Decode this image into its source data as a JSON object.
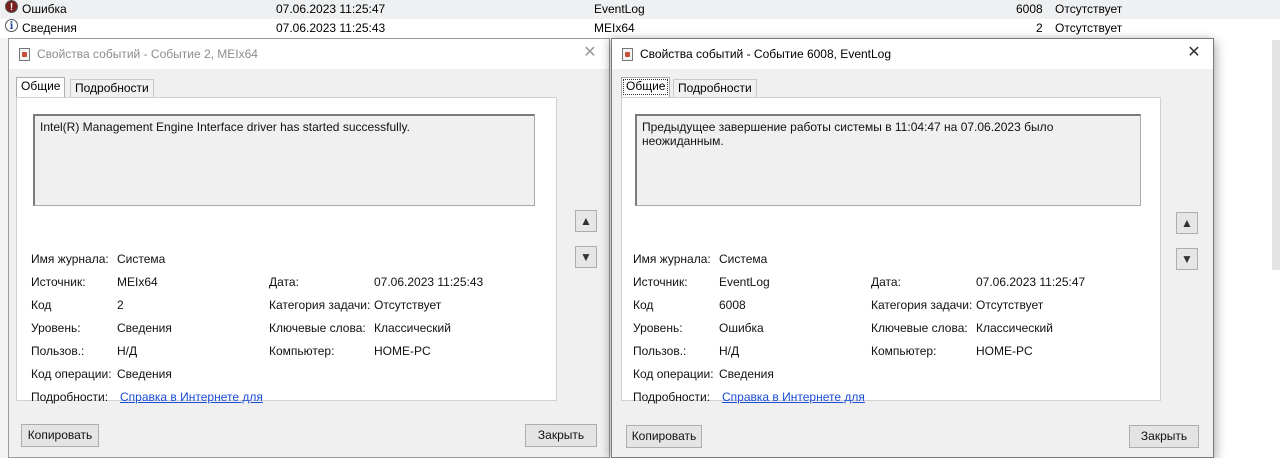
{
  "event_list": {
    "rows": [
      {
        "level": "Ошибка",
        "date": "07.06.2023 11:25:47",
        "source": "EventLog",
        "code": "6008",
        "category": "Отсутствует"
      },
      {
        "level": "Сведения",
        "date": "07.06.2023 11:25:43",
        "source": "MEIx64",
        "code": "2",
        "category": "Отсутствует"
      }
    ]
  },
  "dialog_left": {
    "title": "Свойства событий - Событие 2, MEIx64",
    "tabs": [
      "Общие",
      "Подробности"
    ],
    "message": "Intel(R) Management Engine Interface driver has started successfully.",
    "labels": {
      "log_name": "Имя журнала:",
      "source": "Источник:",
      "code": "Код",
      "level": "Уровень:",
      "user": "Пользов.:",
      "opcode": "Код операции:",
      "details": "Подробности:",
      "date": "Дата:",
      "task_category": "Категория задачи:",
      "keywords": "Ключевые слова:",
      "computer": "Компьютер:"
    },
    "values": {
      "log_name": "Система",
      "source": "MEIx64",
      "code": "2",
      "level": "Сведения",
      "user": "Н/Д",
      "opcode": "Сведения",
      "details_link": "Справка в Интернете для",
      "date": "07.06.2023 11:25:43",
      "task_category": "Отсутствует",
      "keywords": "Классический",
      "computer": "HOME-PC"
    },
    "copy_button": "Копировать",
    "close_button": "Закрыть"
  },
  "dialog_right": {
    "title": "Свойства событий - Событие 6008, EventLog",
    "tabs": [
      "Общие",
      "Подробности"
    ],
    "message": "Предыдущее завершение работы системы в 11:04:47 на 07.06.2023 было неожиданным.",
    "labels": {
      "log_name": "Имя журнала:",
      "source": "Источник:",
      "code": "Код",
      "level": "Уровень:",
      "user": "Пользов.:",
      "opcode": "Код операции:",
      "details": "Подробности:",
      "date": "Дата:",
      "task_category": "Категория задачи:",
      "keywords": "Ключевые слова:",
      "computer": "Компьютер:"
    },
    "values": {
      "log_name": "Система",
      "source": "EventLog",
      "code": "6008",
      "level": "Ошибка",
      "user": "Н/Д",
      "opcode": "Сведения",
      "details_link": "Справка в Интернете для",
      "date": "07.06.2023 11:25:47",
      "task_category": "Отсутствует",
      "keywords": "Классический",
      "computer": "HOME-PC"
    },
    "copy_button": "Копировать",
    "close_button": "Закрыть"
  },
  "icons": {
    "error": "error-icon",
    "info": "info-icon",
    "up": "arrow-up-icon",
    "down": "arrow-down-icon",
    "close": "close-icon"
  }
}
